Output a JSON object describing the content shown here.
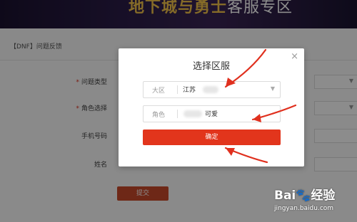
{
  "banner": {
    "title_part1": "地下城与勇士",
    "title_part2": "客服专区"
  },
  "breadcrumb": "【DNF】问题反馈",
  "form": {
    "fields": [
      {
        "label": "问题类型",
        "required": true
      },
      {
        "label": "角色选择",
        "required": true
      },
      {
        "label": "手机号码",
        "required": false
      },
      {
        "label": "姓名",
        "required": false
      }
    ],
    "required_mark": "*",
    "submit_label": "提交"
  },
  "modal": {
    "title": "选择区服",
    "close_glyph": "×",
    "region": {
      "label": "大区",
      "value": "江苏"
    },
    "role": {
      "label": "角色",
      "value": "可爱"
    },
    "confirm_label": "确定"
  },
  "watermark": {
    "brand": "Bai",
    "brand_suffix": "经验",
    "url": "jingyan.baidu.com"
  },
  "colors": {
    "accent_red": "#e2351c",
    "annotation_red": "#e0301e",
    "banner_gold": "#f2c34a"
  },
  "icons": {
    "caret": "caret-down-icon",
    "close": "close-icon",
    "arrow": "red-annotation-arrow"
  }
}
